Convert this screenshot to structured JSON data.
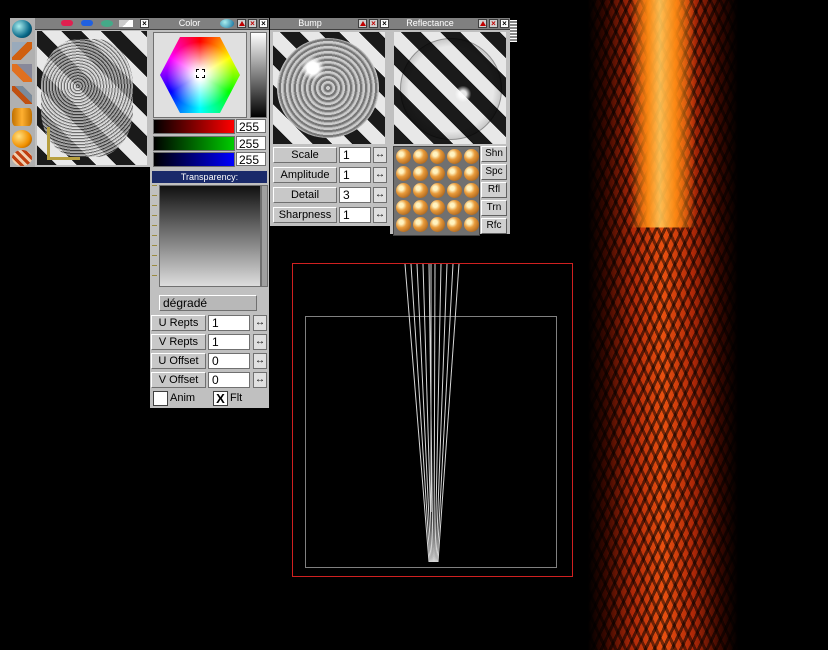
{
  "tool_panel": {
    "icons": [
      "sphere-icon",
      "wrench-icon",
      "paint-icon",
      "pencil-icon",
      "cylinder-icon",
      "orange-sphere-icon",
      "striped-sphere-icon"
    ]
  },
  "texture_panel": {
    "title_icons": [
      "red-pill-icon",
      "blue-pill-icon",
      "globe-icon",
      "wand-icon"
    ]
  },
  "color_panel": {
    "title": "Color",
    "rgb": {
      "r": "255",
      "g": "255",
      "b": "255"
    },
    "transparency_label": "Transparency:",
    "gradient_name": "dégradé",
    "params": [
      {
        "label": "U Repts",
        "value": "1"
      },
      {
        "label": "V Repts",
        "value": "1"
      },
      {
        "label": "U Offset",
        "value": "0"
      },
      {
        "label": "V Offset",
        "value": "0"
      }
    ],
    "anim_label": "Anim",
    "flt_label": "Flt",
    "flt_checked_glyph": "X"
  },
  "bump_panel": {
    "title": "Bump",
    "params": [
      {
        "label": "Scale",
        "value": "1"
      },
      {
        "label": "Amplitude",
        "value": "1"
      },
      {
        "label": "Detail",
        "value": "3"
      },
      {
        "label": "Sharpness",
        "value": "1"
      }
    ]
  },
  "reflectance_panel": {
    "title": "Reflectance",
    "buttons": [
      "Shn",
      "Spc",
      "Rfl",
      "Trn",
      "Rfc"
    ]
  },
  "colors": {
    "panel_bg": "#c0c0c0",
    "titlebar": "#808080",
    "transparency_header": "#1a2a6a",
    "viewport_border": "#d02020",
    "accent_red": "#c00000"
  }
}
